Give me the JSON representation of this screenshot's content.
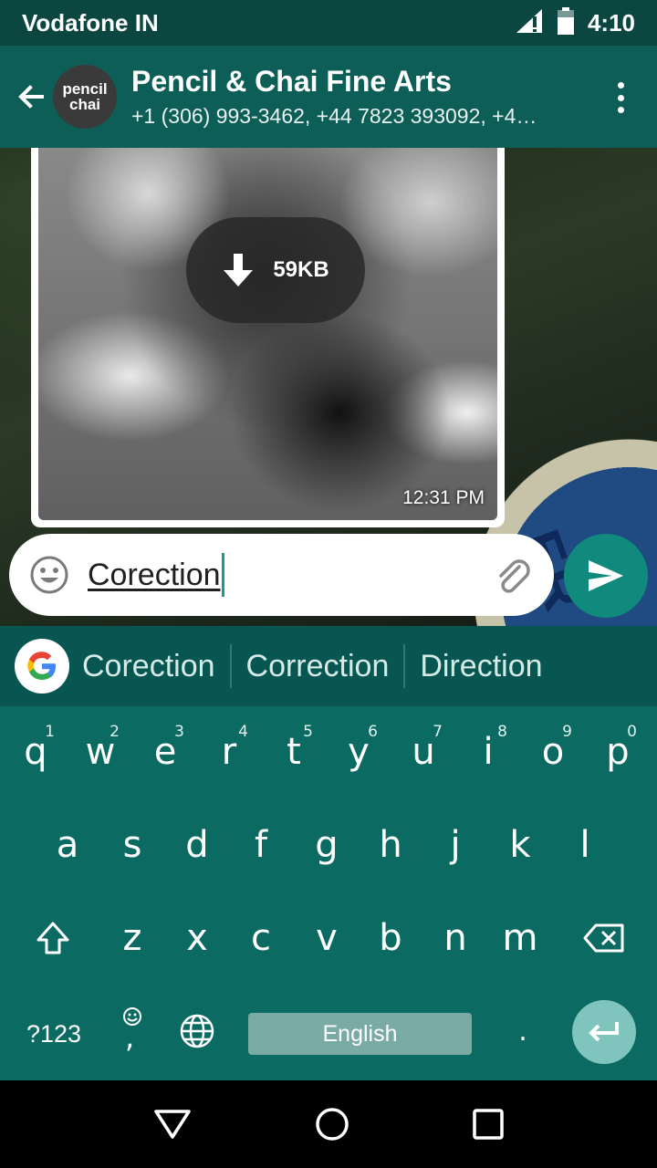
{
  "status_bar": {
    "carrier": "Vodafone IN",
    "time": "4:10",
    "icons": [
      "signal-icon",
      "battery-icon"
    ]
  },
  "app_bar": {
    "avatar_text_line1": "pencil",
    "avatar_text_line2": "chai",
    "title": "Pencil & Chai Fine Arts",
    "subtitle": "+1 (306) 993-3462, +44 7823 393092, +4…"
  },
  "message": {
    "download_size": "59KB",
    "time": "12:31 PM"
  },
  "compose": {
    "text": "Corection"
  },
  "suggestions": [
    "Corection",
    "Correction",
    "Direction"
  ],
  "keyboard": {
    "row1": [
      {
        "key": "q",
        "hint": "1"
      },
      {
        "key": "w",
        "hint": "2"
      },
      {
        "key": "e",
        "hint": "3"
      },
      {
        "key": "r",
        "hint": "4"
      },
      {
        "key": "t",
        "hint": "5"
      },
      {
        "key": "y",
        "hint": "6"
      },
      {
        "key": "u",
        "hint": "7"
      },
      {
        "key": "i",
        "hint": "8"
      },
      {
        "key": "o",
        "hint": "9"
      },
      {
        "key": "p",
        "hint": "0"
      }
    ],
    "row2": [
      "a",
      "s",
      "d",
      "f",
      "g",
      "h",
      "j",
      "k",
      "l"
    ],
    "row3": [
      "z",
      "x",
      "c",
      "v",
      "b",
      "n",
      "m"
    ],
    "symbols_label": "?123",
    "comma": ",",
    "period": ".",
    "space_label": "English"
  },
  "colors": {
    "status_bar": "#0b4640",
    "app_bar": "#0d5e56",
    "keyboard": "#0b6b62",
    "send_button": "#0f8a7d"
  }
}
